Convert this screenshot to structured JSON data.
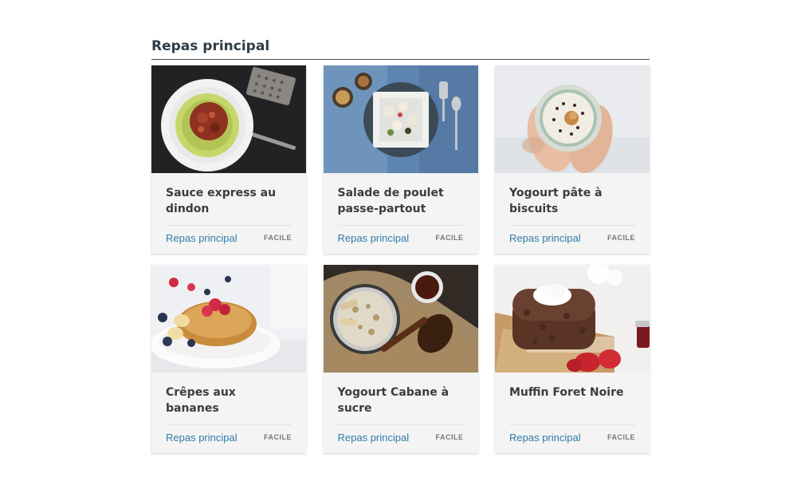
{
  "section": {
    "title": "Repas principal"
  },
  "cards": [
    {
      "title": "Sauce express au dindon",
      "category": "Repas principal",
      "difficulty": "FACILE",
      "image_icon": "zucchini-noodles-bolognese-photo"
    },
    {
      "title": "Salade de poulet passe-partout",
      "category": "Repas principal",
      "difficulty": "FACILE",
      "image_icon": "chicken-salad-bowl-photo"
    },
    {
      "title": "Yogourt pâte à biscuits",
      "category": "Repas principal",
      "difficulty": "FACILE",
      "image_icon": "yogurt-bowl-hands-photo"
    },
    {
      "title": "Crêpes aux bananes",
      "category": "Repas principal",
      "difficulty": "FACILE",
      "image_icon": "banana-pancakes-berries-photo"
    },
    {
      "title": "Yogourt Cabane à sucre",
      "category": "Repas principal",
      "difficulty": "FACILE",
      "image_icon": "maple-yogurt-granola-photo"
    },
    {
      "title": "Muffin Foret Noire",
      "category": "Repas principal",
      "difficulty": "FACILE",
      "image_icon": "black-forest-muffin-photo"
    }
  ]
}
